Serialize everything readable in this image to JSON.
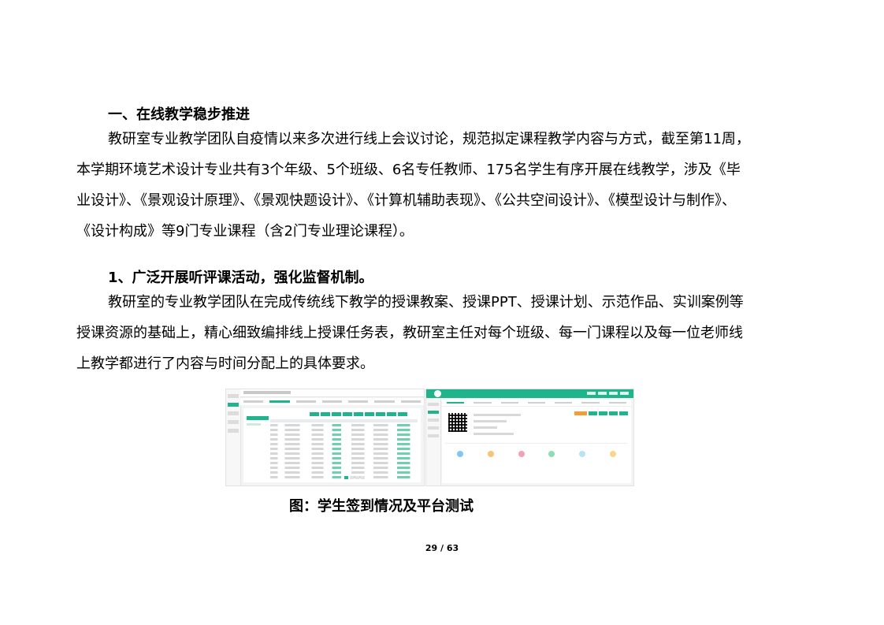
{
  "section_heading": "一、在线教学稳步推进",
  "paragraph1": [
    "教研室专业教学团队自疫情以来多次进行线上会议讨论，规范拟定课程教学内容与方式，截至第11周，",
    "本学期环境艺术设计专业共有3个年级、5个班级、6名专任教师、175名学生有序开展在线教学，涉及《毕",
    "业设计》、《景观设计原理》、《景观快题设计》、《计算机辅助表现》、《公共空间设计》、《模型设计与制作》、",
    "《设计构成》等9门专业课程（含2门专业理论课程）。"
  ],
  "subheading": "1、广泛开展听评课活动，强化监督机制。",
  "paragraph2": [
    "教研室的专业教学团队在完成传统线下教学的授课教案、授课PPT、授课计划、示范作品、实训案例等",
    "授课资源的基础上，精心细致编排线上授课任务表，教研室主任对每个班级、每一门课程以及每一位老师线",
    "上教学都进行了内容与时间分配上的具体要求。"
  ],
  "caption": "图：学生签到情况及平台测试",
  "page_number": "29 / 63",
  "colors": {
    "platform_green": "#1fb48b",
    "accent_orange": "#f39c38"
  }
}
